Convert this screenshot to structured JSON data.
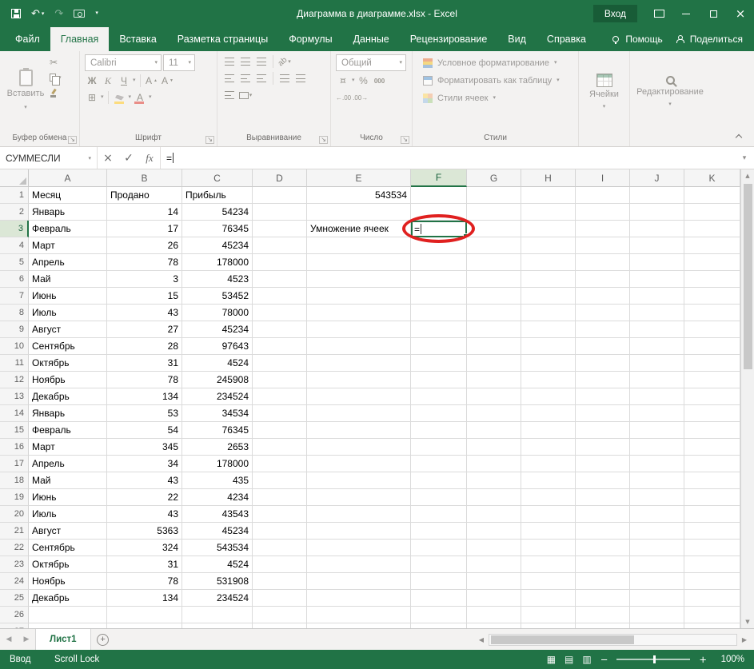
{
  "colors": {
    "accent_green": "#217346",
    "annotation_red": "#e0201f",
    "titlebar_green": "#217346"
  },
  "window": {
    "title": "Диаграмма в диаграмме.xlsx - Excel",
    "sign_in": "Вход"
  },
  "icons": {
    "save": "floppy-disk",
    "undo": "↶",
    "redo": "↷",
    "camera": "camera",
    "qat_customize": "dropdown",
    "close": "×",
    "cut": "✂",
    "copy": "two-pages",
    "format_painter": "brush",
    "cancel": "×",
    "enter": "✓",
    "insert_function": "fx",
    "borders": "⊞",
    "currency": "¤",
    "increase_decimal": "←.00",
    "decrease_decimal": ".00→",
    "prev_sheet": "◀",
    "next_sheet": "▶",
    "scroll_up": "▲",
    "scroll_down": "▼",
    "scroll_left": "◀",
    "scroll_right": "▶",
    "add_sheet": "+",
    "view_normal": "▦",
    "view_page_layout": "▤",
    "view_page_break": "▥",
    "zoom_out": "−",
    "zoom_in": "+",
    "launcher": "↘",
    "expand_formula_bar": "▾"
  },
  "ribbon": {
    "tabs": [
      {
        "label": "Файл"
      },
      {
        "label": "Главная",
        "active": true
      },
      {
        "label": "Вставка"
      },
      {
        "label": "Разметка страницы"
      },
      {
        "label": "Формулы"
      },
      {
        "label": "Данные"
      },
      {
        "label": "Рецензирование"
      },
      {
        "label": "Вид"
      },
      {
        "label": "Справка"
      }
    ],
    "help_label": "Помощь",
    "share_label": "Поделиться",
    "clipboard": {
      "paste": "Вставить",
      "group": "Буфер обмена"
    },
    "font": {
      "name": "Calibri",
      "size": "11",
      "bold": "Ж",
      "italic": "К",
      "underline": "Ч",
      "letter": "А",
      "group": "Шрифт"
    },
    "alignment": {
      "orientation": "ab",
      "group": "Выравнивание"
    },
    "number": {
      "format": "Общий",
      "percent": "%",
      "thousands": "000",
      "group": "Число"
    },
    "styles": {
      "conditional": "Условное форматирование",
      "format_table": "Форматировать как таблицу",
      "cell_styles": "Стили ячеек",
      "group": "Стили"
    },
    "cells": {
      "label": "Ячейки"
    },
    "editing": {
      "label": "Редактирование"
    }
  },
  "formula_bar": {
    "name_box": "СУММЕСЛИ",
    "formula": "="
  },
  "sheet": {
    "columns": [
      "A",
      "B",
      "C",
      "D",
      "E",
      "F",
      "G",
      "H",
      "I",
      "J",
      "K"
    ],
    "active": {
      "col": "F",
      "row": 3,
      "value": "="
    },
    "rows": [
      {
        "n": 1,
        "A": "Месяц",
        "B": "Продано",
        "C": "Прибыль",
        "E": "543534"
      },
      {
        "n": 2,
        "A": "Январь",
        "B": "14",
        "C": "54234"
      },
      {
        "n": 3,
        "A": "Февраль",
        "B": "17",
        "C": "76345",
        "E": "Умножение ячеек"
      },
      {
        "n": 4,
        "A": "Март",
        "B": "26",
        "C": "45234"
      },
      {
        "n": 5,
        "A": "Апрель",
        "B": "78",
        "C": "178000"
      },
      {
        "n": 6,
        "A": "Май",
        "B": "3",
        "C": "4523"
      },
      {
        "n": 7,
        "A": "Июнь",
        "B": "15",
        "C": "53452"
      },
      {
        "n": 8,
        "A": "Июль",
        "B": "43",
        "C": "78000"
      },
      {
        "n": 9,
        "A": "Август",
        "B": "27",
        "C": "45234"
      },
      {
        "n": 10,
        "A": "Сентябрь",
        "B": "28",
        "C": "97643"
      },
      {
        "n": 11,
        "A": "Октябрь",
        "B": "31",
        "C": "4524"
      },
      {
        "n": 12,
        "A": "Ноябрь",
        "B": "78",
        "C": "245908"
      },
      {
        "n": 13,
        "A": "Декабрь",
        "B": "134",
        "C": "234524"
      },
      {
        "n": 14,
        "A": "Январь",
        "B": "53",
        "C": "34534"
      },
      {
        "n": 15,
        "A": "Февраль",
        "B": "54",
        "C": "76345"
      },
      {
        "n": 16,
        "A": "Март",
        "B": "345",
        "C": "2653"
      },
      {
        "n": 17,
        "A": "Апрель",
        "B": "34",
        "C": "178000"
      },
      {
        "n": 18,
        "A": "Май",
        "B": "43",
        "C": "435"
      },
      {
        "n": 19,
        "A": "Июнь",
        "B": "22",
        "C": "4234"
      },
      {
        "n": 20,
        "A": "Июль",
        "B": "43",
        "C": "43543"
      },
      {
        "n": 21,
        "A": "Август",
        "B": "5363",
        "C": "45234"
      },
      {
        "n": 22,
        "A": "Сентябрь",
        "B": "324",
        "C": "543534"
      },
      {
        "n": 23,
        "A": "Октябрь",
        "B": "31",
        "C": "4524"
      },
      {
        "n": 24,
        "A": "Ноябрь",
        "B": "78",
        "C": "531908"
      },
      {
        "n": 25,
        "A": "Декабрь",
        "B": "134",
        "C": "234524"
      }
    ]
  },
  "tabs_bar": {
    "sheet": "Лист1"
  },
  "status_bar": {
    "mode": "Ввод",
    "scroll_lock": "Scroll Lock",
    "zoom": "100%"
  }
}
